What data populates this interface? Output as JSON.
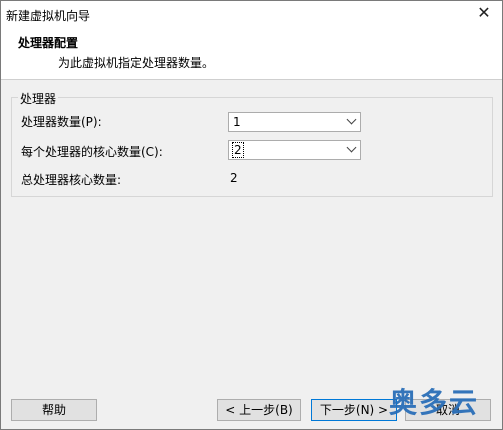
{
  "window": {
    "title": "新建虚拟机向导"
  },
  "header": {
    "title": "处理器配置",
    "subtitle": "为此虚拟机指定处理器数量。"
  },
  "group": {
    "label": "处理器",
    "processor_count_label": "处理器数量(P):",
    "processor_count_value": "1",
    "cores_per_processor_label": "每个处理器的核心数量(C):",
    "cores_per_processor_value": "2",
    "total_cores_label": "总处理器核心数量:",
    "total_cores_value": "2"
  },
  "buttons": {
    "help": "帮助",
    "back": "< 上一步(B)",
    "next": "下一步(N) >",
    "cancel": "取消"
  },
  "watermark": "奥多云",
  "icons": {
    "close": "close-icon",
    "dropdown": "chevron-down-icon"
  }
}
